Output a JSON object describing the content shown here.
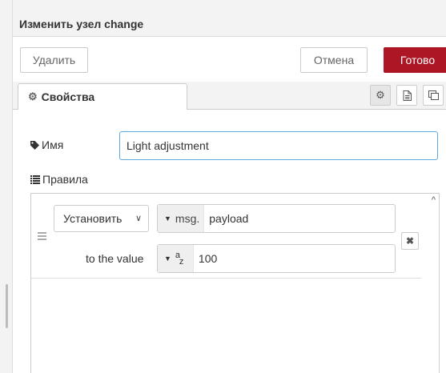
{
  "header": {
    "title": "Изменить узел change"
  },
  "toolbar": {
    "delete_label": "Удалить",
    "cancel_label": "Отмена",
    "done_label": "Готово"
  },
  "tabs": {
    "properties_label": "Свойства",
    "icons": [
      "gear-icon",
      "file-text-icon",
      "window-icon"
    ]
  },
  "form": {
    "name_label": "Имя",
    "name_value": "Light adjustment",
    "rules_label": "Правила"
  },
  "rules": [
    {
      "action": "Установить",
      "target_type": "msg.",
      "target_value": "payload",
      "to_label": "to the value",
      "value_type_icon": "string-az-icon",
      "value_type_a": "a",
      "value_type_z": "z",
      "value": "100"
    }
  ],
  "colors": {
    "accent_primary": "#ad1625",
    "input_focus_border": "#5fa9e1",
    "panel_bg": "#f3f3f3"
  }
}
